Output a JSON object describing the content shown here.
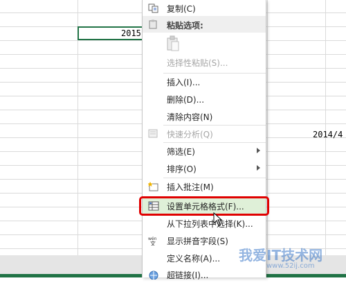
{
  "sheet": {
    "cell_2015": "2015",
    "cell_2014": "2014/4"
  },
  "menu": {
    "copy": "复制(C)",
    "paste_options_header": "粘贴选项:",
    "paste_special": "选择性粘贴(S)...",
    "insert": "插入(I)...",
    "delete": "删除(D)...",
    "clear_contents": "清除内容(N)",
    "quick_analysis": "快速分析(Q)",
    "filter": "筛选(E)",
    "sort": "排序(O)",
    "insert_comment": "插入批注(M)",
    "format_cells": "设置单元格格式(F)...",
    "pick_from_list": "从下拉列表中选择(K)...",
    "show_phonetic": "显示拼音字段(S)",
    "define_name": "定义名称(A)...",
    "hyperlink": "超链接(I)..."
  },
  "watermark": {
    "main": "我爱IT技术网",
    "sub": "www.52ij.com"
  },
  "colors": {
    "accent": "#217346",
    "highlight": "#e00000",
    "hover": "#dff0d8"
  }
}
